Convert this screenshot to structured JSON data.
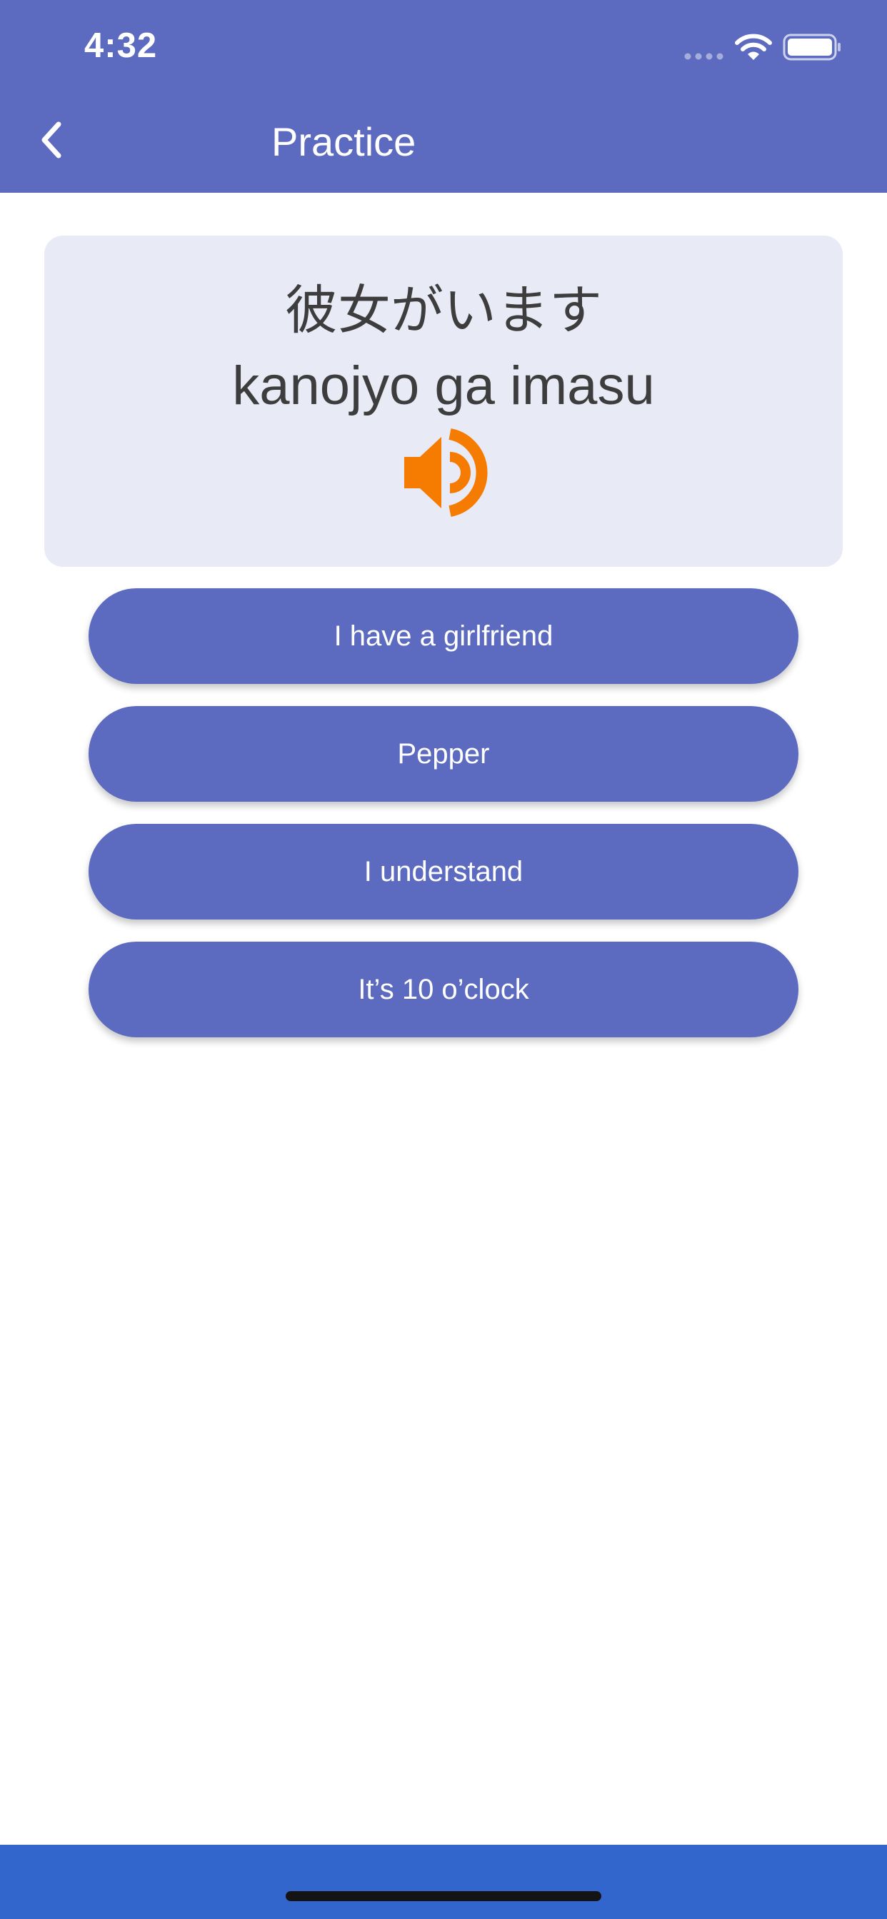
{
  "status_bar": {
    "time": "4:32"
  },
  "nav": {
    "title": "Practice",
    "back_icon": "chevron-left-icon"
  },
  "question": {
    "japanese": "彼女がいます",
    "romaji": "kanojyo ga imasu",
    "audio_icon": "speaker-icon"
  },
  "options": [
    {
      "label": "I have a girlfriend"
    },
    {
      "label": "Pepper"
    },
    {
      "label": "I understand"
    },
    {
      "label": "It’s 10 o’clock"
    }
  ],
  "colors": {
    "header": "#5c6bc0",
    "card": "#e8eaf6",
    "button": "#5c6bc0",
    "accent": "#f57c00",
    "bottom_bar": "#3266cc"
  }
}
